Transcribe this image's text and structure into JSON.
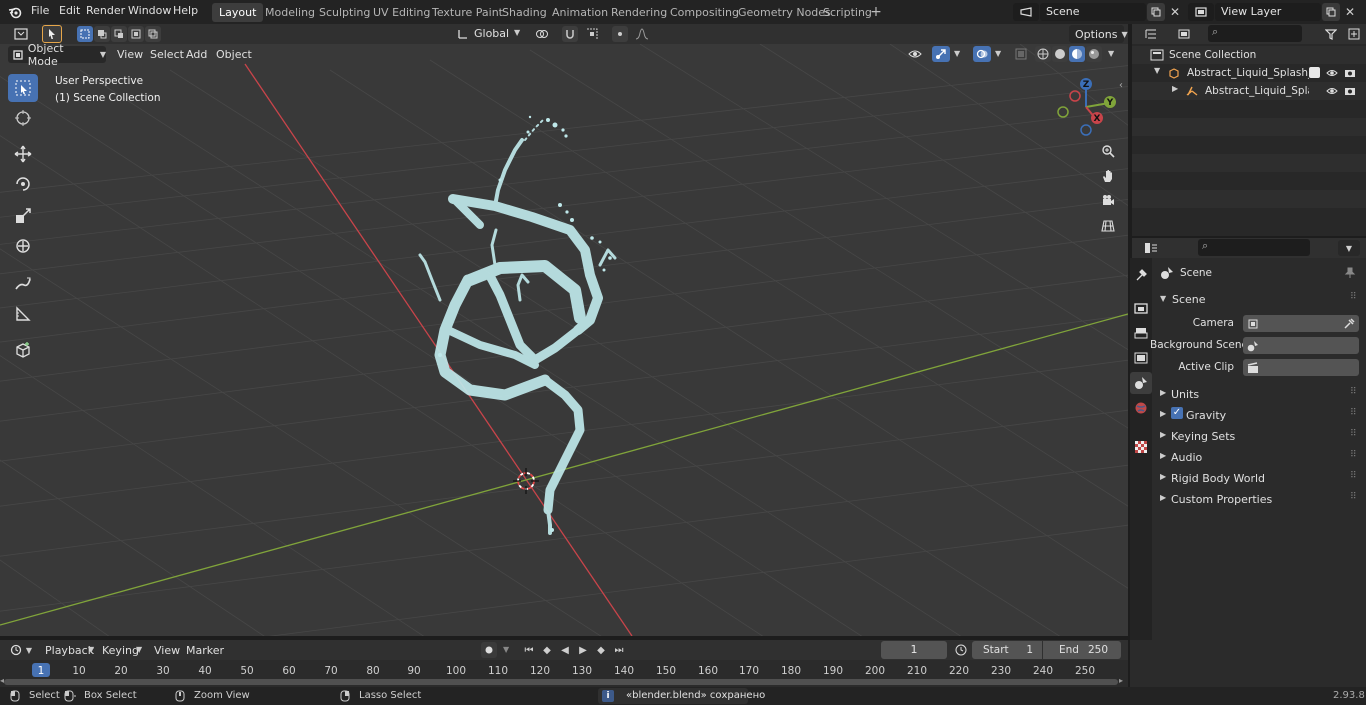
{
  "app": {
    "menus": [
      "File",
      "Edit",
      "Render",
      "Window",
      "Help"
    ],
    "workspaces": [
      "Layout",
      "Modeling",
      "Sculpting",
      "UV Editing",
      "Texture Paint",
      "Shading",
      "Animation",
      "Rendering",
      "Compositing",
      "Geometry Nodes",
      "Scripting"
    ],
    "active_workspace": "Layout",
    "scene_name": "Scene",
    "view_layer": "View Layer"
  },
  "header": {
    "orientation": "Global",
    "options_label": "Options"
  },
  "viewport": {
    "mode": "Object Mode",
    "menus": [
      "View",
      "Select",
      "Add",
      "Object"
    ],
    "perspective_label": "User Perspective",
    "collection_label": "(1) Scene Collection",
    "gizmo": {
      "x": "X",
      "y": "Y",
      "z": "Z"
    }
  },
  "outliner": {
    "root": "Scene Collection",
    "items": [
      {
        "label": "Abstract_Liquid_Splash_Blue_"
      },
      {
        "label": "Abstract_Liquid_Splash_E"
      }
    ]
  },
  "properties": {
    "context_title": "Scene",
    "panel_title": "Scene",
    "fields": [
      {
        "label": "Camera"
      },
      {
        "label": "Background Scene"
      },
      {
        "label": "Active Clip"
      }
    ],
    "sections": [
      "Units",
      "Gravity",
      "Keying Sets",
      "Audio",
      "Rigid Body World",
      "Custom Properties"
    ]
  },
  "timeline": {
    "menus": [
      "Playback",
      "Keying",
      "View",
      "Marker"
    ],
    "current_frame": "1",
    "start_label": "Start",
    "start_value": "1",
    "end_label": "End",
    "end_value": "250",
    "ticks": [
      "1",
      "10",
      "20",
      "30",
      "40",
      "50",
      "60",
      "70",
      "80",
      "90",
      "100",
      "110",
      "120",
      "130",
      "140",
      "150",
      "160",
      "170",
      "180",
      "190",
      "200",
      "210",
      "220",
      "230",
      "240",
      "250"
    ]
  },
  "statusbar": {
    "select": "Select",
    "box_select": "Box Select",
    "zoom_view": "Zoom View",
    "lasso_select": "Lasso Select",
    "message": "«blender.blend» сохранено",
    "version": "2.93.8"
  },
  "colors": {
    "accent": "#4772b3",
    "x_axis": "#c8444a",
    "y_axis": "#80a43a",
    "splash": "#bfe8ea"
  }
}
